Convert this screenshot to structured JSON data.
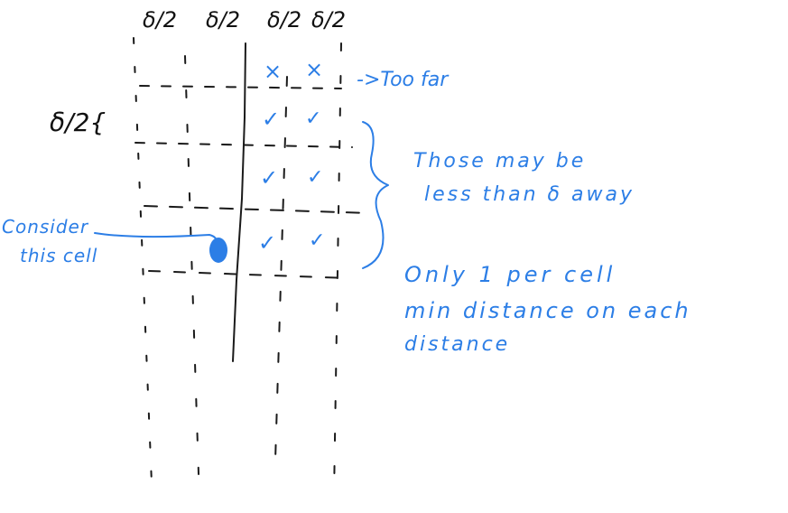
{
  "column_labels": [
    "δ/2",
    "δ/2",
    "δ/2",
    "δ/2"
  ],
  "row_label": "δ/2{",
  "annotations": {
    "too_far": "->Too far",
    "those_may_be_line1": "Those may be",
    "those_may_be_line2": "less than δ away",
    "consider_line1": "Consider",
    "consider_line2": "this cell",
    "only_line1": "Only 1 per cell",
    "only_line2": "min distance on each",
    "only_line3": "distance"
  },
  "marks": {
    "cross": "×",
    "check": "✓"
  },
  "colors": {
    "ink": "#1a1a1a",
    "annotation": "#2c7ee6"
  }
}
